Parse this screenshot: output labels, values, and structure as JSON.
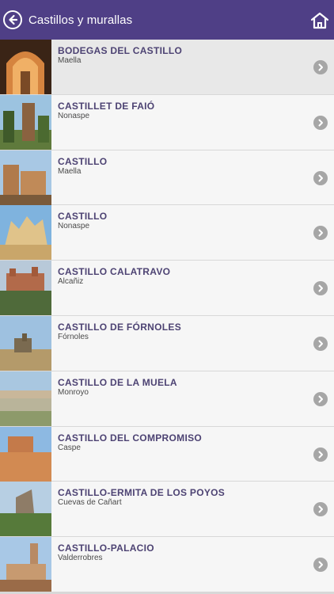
{
  "header": {
    "title": "Castillos y murallas",
    "back_icon": "back-arrow-circle-icon",
    "home_icon": "home-icon",
    "bg": "#4f3f86"
  },
  "items": [
    {
      "name": "BODEGAS DEL CASTILLO",
      "location": "Maella"
    },
    {
      "name": "CASTILLET DE FAIÓ",
      "location": "Nonaspe"
    },
    {
      "name": "CASTILLO",
      "location": "Maella"
    },
    {
      "name": "CASTILLO",
      "location": "Nonaspe"
    },
    {
      "name": "CASTILLO CALATRAVO",
      "location": "Alcañiz"
    },
    {
      "name": "CASTILLO DE FÓRNOLES",
      "location": "Fórnoles"
    },
    {
      "name": "CASTILLO DE LA MUELA",
      "location": "Monroyo"
    },
    {
      "name": "CASTILLO DEL COMPROMISO",
      "location": "Caspe"
    },
    {
      "name": "CASTILLO-ERMITA DE LOS POYOS",
      "location": "Cuevas de Cañart"
    },
    {
      "name": "CASTILLO-PALACIO",
      "location": "Valderrobres"
    }
  ],
  "colors": {
    "title_text": "#4d4373",
    "chevron": "#a6a6a6"
  }
}
